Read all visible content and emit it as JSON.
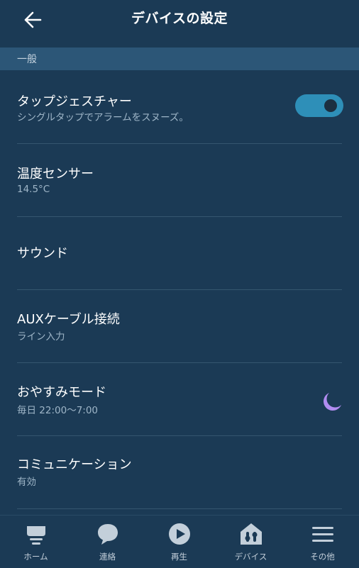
{
  "header": {
    "title": "デバイスの設定"
  },
  "section": {
    "label": "一般"
  },
  "rows": [
    {
      "title": "タップジェスチャー",
      "subtitle": "シングルタップでアラームをスヌーズ。"
    },
    {
      "title": "温度センサー",
      "subtitle": "14.5°C"
    },
    {
      "title": "サウンド"
    },
    {
      "title": "AUXケーブル接続",
      "subtitle": "ライン入力"
    },
    {
      "title": "おやすみモード",
      "subtitle": "毎日 22:00〜7:00"
    },
    {
      "title": "コミュニケーション",
      "subtitle": "有効"
    }
  ],
  "tap_gesture_toggle": {
    "on": true,
    "color": "#2e8fb8"
  },
  "do_not_disturb_icon": {
    "icon": "moon-icon",
    "color": "#b18cf0"
  },
  "bottom_nav": [
    {
      "label": "ホーム",
      "icon": "home-icon"
    },
    {
      "label": "連絡",
      "icon": "chat-bubble-icon"
    },
    {
      "label": "再生",
      "icon": "play-icon"
    },
    {
      "label": "デバイス",
      "icon": "devices-icon"
    },
    {
      "label": "その他",
      "icon": "menu-icon"
    }
  ],
  "colors": {
    "background": "#1b3a55",
    "section": "#2c5677",
    "subtitle": "#9fb6c8"
  }
}
